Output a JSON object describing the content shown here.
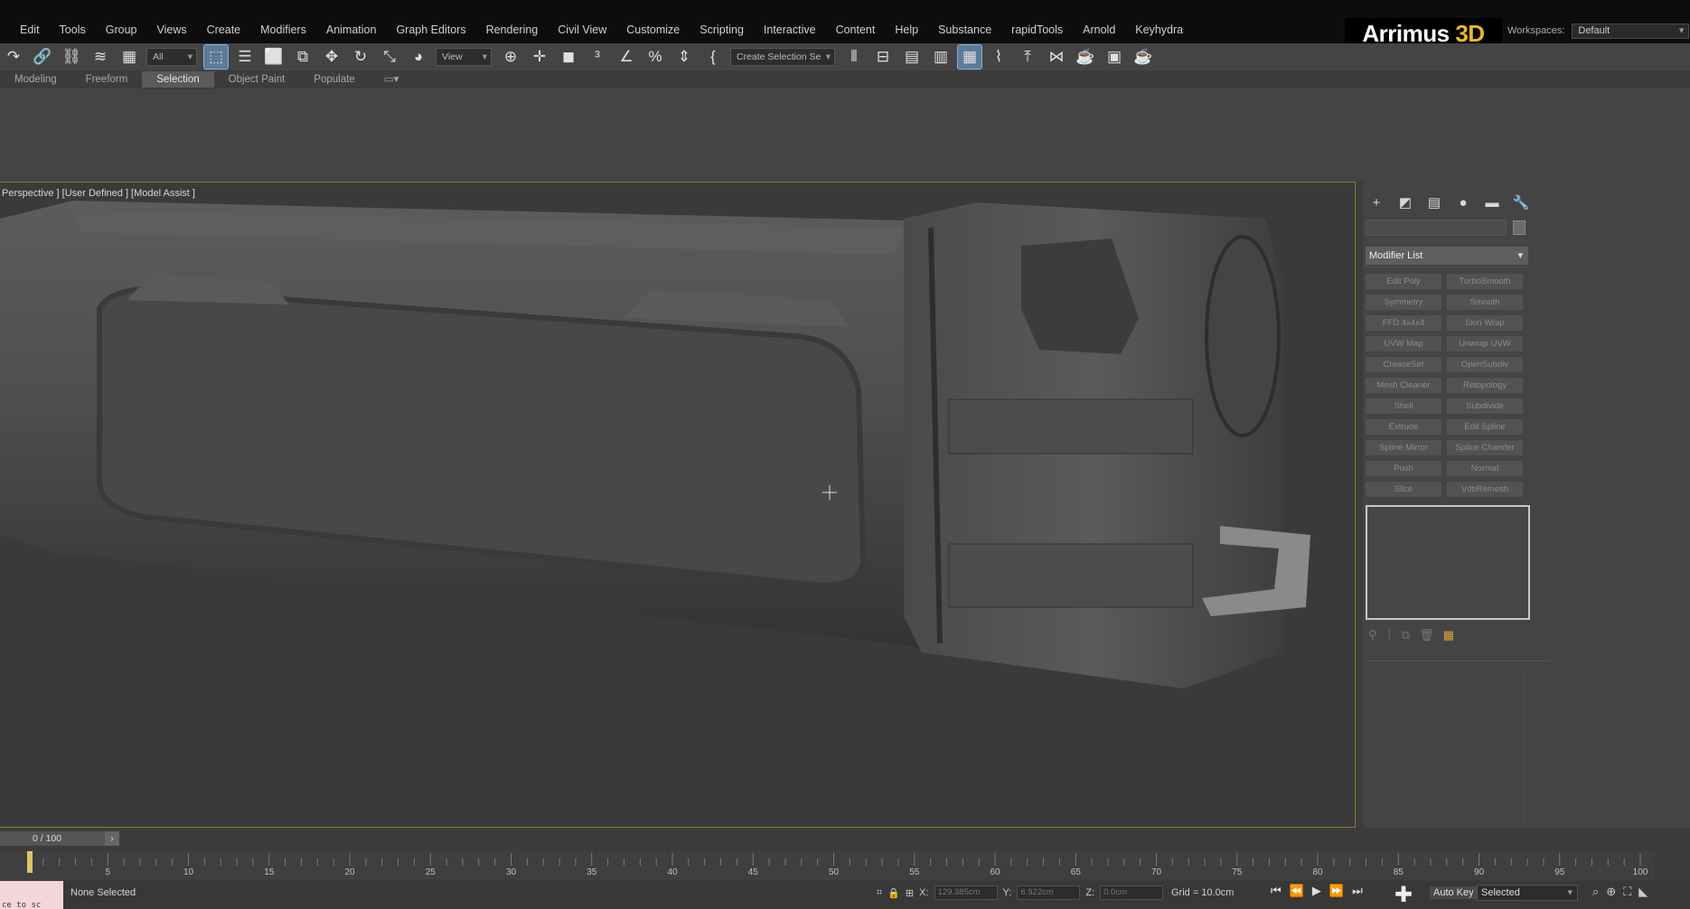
{
  "menu": [
    "Edit",
    "Tools",
    "Group",
    "Views",
    "Create",
    "Modifiers",
    "Animation",
    "Graph Editors",
    "Rendering",
    "Civil View",
    "Customize",
    "Scripting",
    "Interactive",
    "Content",
    "Help",
    "Substance",
    "rapidTools",
    "Arnold",
    "Keyhydra"
  ],
  "brand": {
    "name": "Arrimus ",
    "accent": "3D"
  },
  "workspaces": {
    "label": "Workspaces:",
    "value": "Default"
  },
  "toolbar": {
    "filter_value": "All",
    "refcoord_value": "View",
    "named_selection_value": "Create Selection Se"
  },
  "ribbon_tabs": [
    "Modeling",
    "Freeform",
    "Selection",
    "Object Paint",
    "Populate"
  ],
  "ribbon_active": "Selection",
  "viewport": {
    "label": "Perspective ] [User Defined ] [Model Assist ]"
  },
  "command_panel": {
    "modifier_list_label": "Modifier List",
    "modifiers": [
      "Edit Poly",
      "TurboSmooth",
      "Symmetry",
      "Smooth",
      "FFD 4x4x4",
      "Skin Wrap",
      "UVW Map",
      "Unwrap UVW",
      "CreaseSet",
      "OpenSubdiv",
      "Mesh Cleaner",
      "Retopology",
      "Shell",
      "Subdivide",
      "Extrude",
      "Edit Spline",
      "Spline Mirror",
      "Spline Chamfer",
      "Push",
      "Normal",
      "Slice",
      "VdbRemesh"
    ]
  },
  "timeline": {
    "frame_counter": "0 / 100",
    "ticks": [
      "5",
      "10",
      "15",
      "20",
      "25",
      "30",
      "35",
      "40",
      "45",
      "50",
      "55",
      "60",
      "65",
      "70",
      "75",
      "80",
      "85",
      "90",
      "95",
      "100"
    ]
  },
  "status": {
    "message": "None Selected",
    "maxscript_text": "ce to sc",
    "x_label": "X:",
    "x_value": "129.385cm",
    "y_label": "Y:",
    "y_value": "6.922cm",
    "z_label": "Z:",
    "z_value": "0.0cm",
    "grid": "Grid = 10.0cm",
    "autokey": "Auto Key",
    "key_filter": "Selected"
  },
  "colors": {
    "viewport_border": "#8f7a2a",
    "accent": "#e9b91f",
    "active_tool": "#5d7a9a"
  }
}
